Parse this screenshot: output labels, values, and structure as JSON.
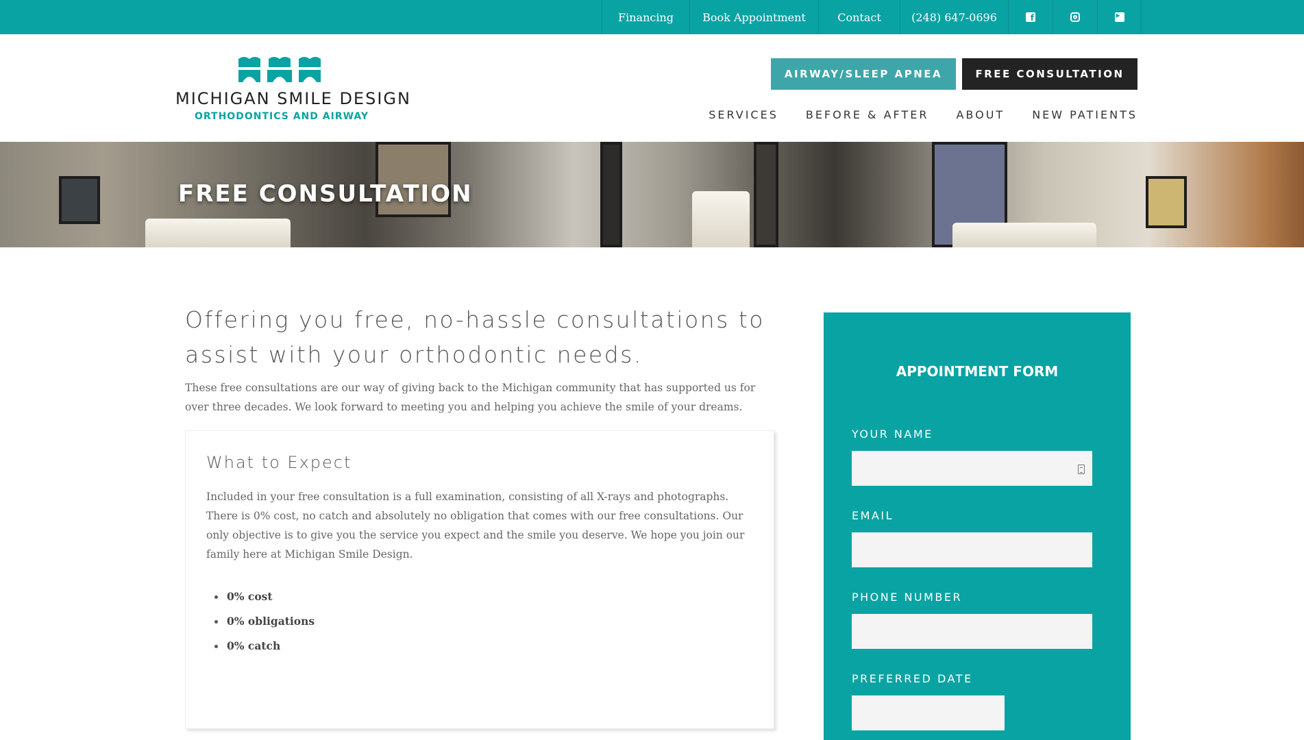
{
  "topbar": {
    "links": {
      "financing": "Financing",
      "book": "Book Appointment",
      "contact": "Contact",
      "phone": "(248) 647-0696"
    },
    "social_icons": [
      "facebook-icon",
      "instagram-icon",
      "twitter-icon"
    ]
  },
  "header": {
    "logo": {
      "name": "MICHIGAN SMILE DESIGN",
      "tagline": "ORTHODONTICS AND AIRWAY"
    },
    "cta": {
      "airway": "AIRWAY/SLEEP APNEA",
      "consult": "FREE CONSULTATION"
    },
    "nav": [
      "SERVICES",
      "BEFORE & AFTER",
      "ABOUT",
      "NEW PATIENTS"
    ]
  },
  "hero": {
    "title": "FREE CONSULTATION"
  },
  "main": {
    "heading": "Offering you free, no-hassle consultations to assist with your orthodontic needs.",
    "intro": "These free consultations are our way of giving back to the Michigan community that has supported us for over three decades. We look forward to meeting you and helping you achieve the smile of your dreams.",
    "expect": {
      "title": "What to Expect",
      "body": "Included in your free consultation is a full examination, consisting of all X-rays and photographs. There is 0% cost, no catch and absolutely no obligation that comes with our free consultations. Our only objective is to give you the service you expect and the smile you deserve. We hope you join our family here at Michigan Smile Design.",
      "bullets": [
        "0% cost",
        "0% obligations",
        "0% catch"
      ]
    }
  },
  "form": {
    "title": "APPOINTMENT FORM",
    "fields": {
      "name_label": "YOUR NAME",
      "name_value": "",
      "email_label": "EMAIL",
      "email_value": "",
      "phone_label": "PHONE NUMBER",
      "phone_value": "",
      "date_label": "PREFERRED DATE",
      "date_value": ""
    }
  },
  "colors": {
    "brand_teal": "#0aa3a3",
    "airway_button": "#3ea6a9",
    "consult_button": "#232324",
    "field_bg": "#f4f4f4"
  }
}
